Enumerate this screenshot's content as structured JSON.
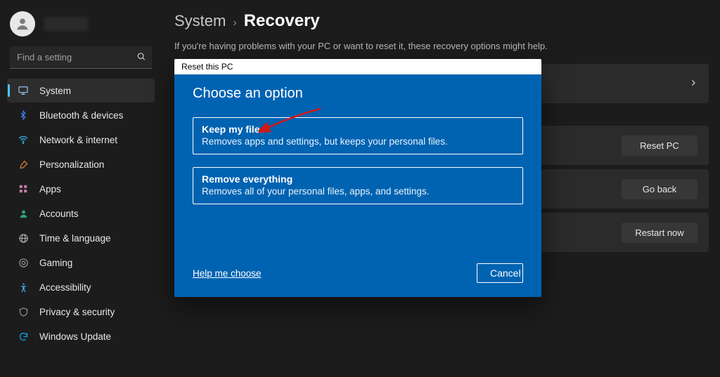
{
  "search": {
    "placeholder": "Find a setting"
  },
  "nav": {
    "items": [
      {
        "label": "System"
      },
      {
        "label": "Bluetooth & devices"
      },
      {
        "label": "Network & internet"
      },
      {
        "label": "Personalization"
      },
      {
        "label": "Apps"
      },
      {
        "label": "Accounts"
      },
      {
        "label": "Time & language"
      },
      {
        "label": "Gaming"
      },
      {
        "label": "Accessibility"
      },
      {
        "label": "Privacy & security"
      },
      {
        "label": "Windows Update"
      }
    ]
  },
  "breadcrumb": {
    "parent": "System",
    "sep": "›",
    "current": "Recovery"
  },
  "subtitle": "If you're having problems with your PC or want to reset it, these recovery options might help.",
  "buttons": {
    "reset": "Reset PC",
    "goback": "Go back",
    "restart": "Restart now"
  },
  "dialog": {
    "title": "Reset this PC",
    "heading": "Choose an option",
    "option1": {
      "title": "Keep my files",
      "desc": "Removes apps and settings, but keeps your personal files."
    },
    "option2": {
      "title": "Remove everything",
      "desc": "Removes all of your personal files, apps, and settings."
    },
    "help": "Help me choose",
    "cancel": "Cancel"
  }
}
